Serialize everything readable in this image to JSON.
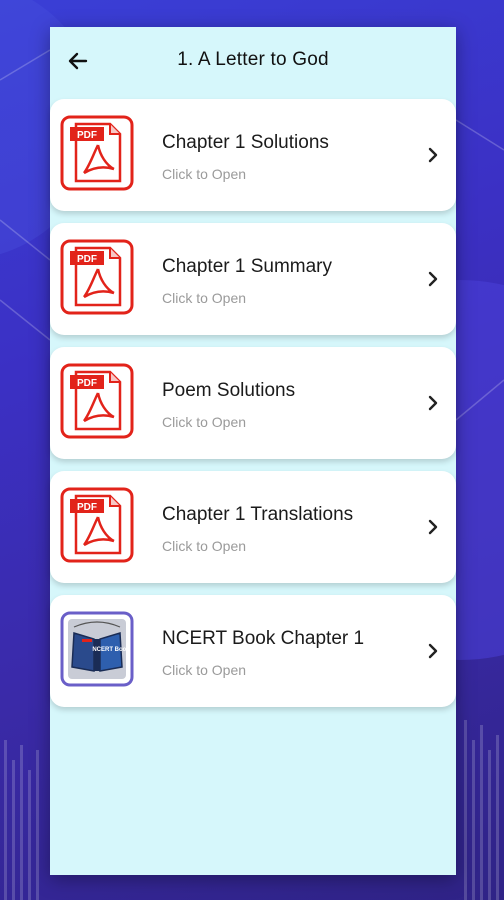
{
  "header": {
    "title": "1. A Letter to God",
    "back_icon": "arrow-left-icon"
  },
  "items": [
    {
      "title": "Chapter 1 Solutions",
      "subtitle": "Click to Open",
      "icon": "pdf-icon",
      "icon_text": "PDF"
    },
    {
      "title": "Chapter 1 Summary",
      "subtitle": "Click to Open",
      "icon": "pdf-icon",
      "icon_text": "PDF"
    },
    {
      "title": "Poem Solutions",
      "subtitle": "Click to Open",
      "icon": "pdf-icon",
      "icon_text": "PDF"
    },
    {
      "title": "Chapter 1 Translations",
      "subtitle": "Click to Open",
      "icon": "pdf-icon",
      "icon_text": "PDF"
    },
    {
      "title": "NCERT Book Chapter 1",
      "subtitle": "Click to Open",
      "icon": "book-icon",
      "icon_text": "NCERT Book"
    }
  ],
  "colors": {
    "panel_bg": "#d6f7fb",
    "pdf_red": "#e2231a",
    "book_purple": "#6a5fc8",
    "background": "#3b30c4"
  }
}
